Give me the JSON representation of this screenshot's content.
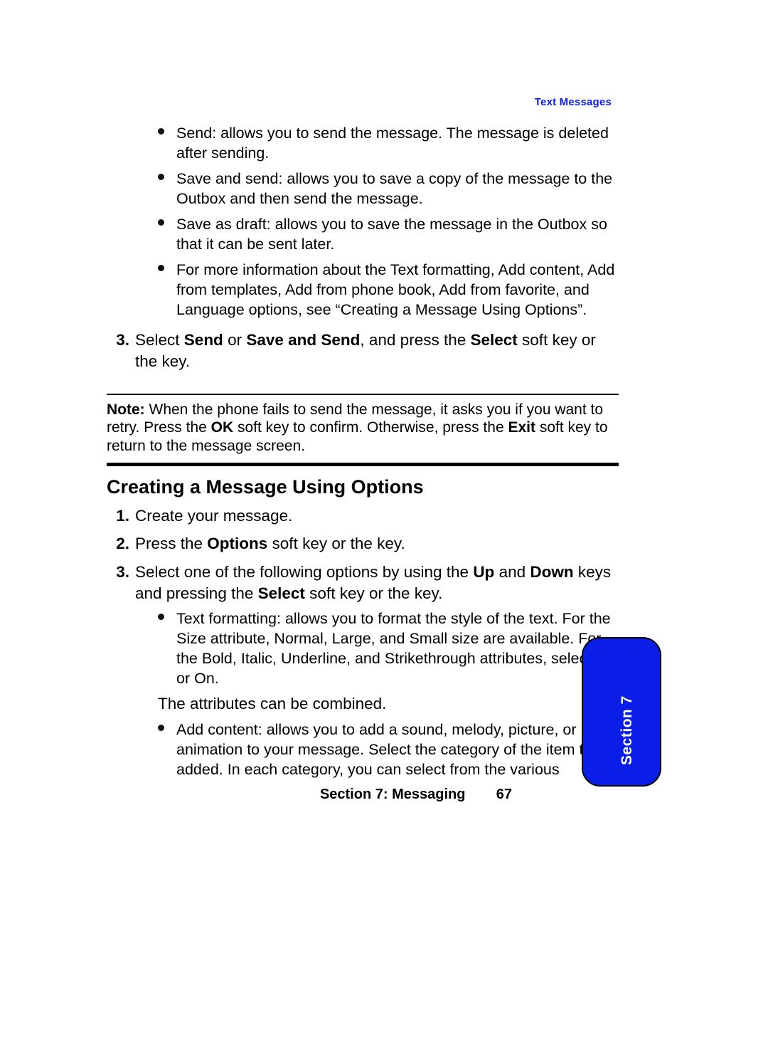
{
  "header": {
    "section_label": "Text Messages"
  },
  "continuing_bullets": [
    "Send: allows you to send the message. The message is deleted after sending.",
    "Save and send: allows you to save a copy of the message to the Outbox and then send the message.",
    "Save as draft: allows you to save the message in the Outbox so that it can be sent later.",
    "For more information about the Text formatting, Add content, Add from  templates, Add from phone book, Add from favorite, and Language options, see “Creating a Message Using Options”."
  ],
  "step3": {
    "number": "3.",
    "prefix": "Select ",
    "bold1": "Send",
    "mid1": " or ",
    "bold2": "Save and Send",
    "mid2": ", and press the ",
    "bold3": "Select",
    "suffix": " soft key or the      key."
  },
  "note": {
    "label": "Note:",
    "text_before_ok": " When the phone fails to send the message, it asks you if you want to retry. Press the ",
    "ok": "OK",
    "text_mid": " soft key to confirm. Otherwise, press the ",
    "exit": "Exit",
    "text_after": " soft key to return to the message screen."
  },
  "heading": "Creating a Message Using Options",
  "steps2": {
    "s1": {
      "num": "1.",
      "text": "Create your message."
    },
    "s2": {
      "num": "2.",
      "pre": "Press the ",
      "bold": "Options",
      "post": " soft key or the       key."
    },
    "s3": {
      "num": "3.",
      "pre": "Select one of the following options by using the ",
      "up": "Up",
      "mid1": " and ",
      "down": "Down",
      "mid2": " keys and pressing the ",
      "select": "Select",
      "post": " soft key or the key."
    }
  },
  "sub2": [
    "Text formatting: allows you to format the style of the text. For the Size attribute, Normal, Large, and Small size are available. For the Bold, Italic, Underline, and Strikethrough attributes, select Off or On."
  ],
  "combine_note": "The attributes can be combined.",
  "sub3": [
    "Add content: allows you to add a sound, melody, picture, or animation to your message. Select the category of the item to be added. In each category, you can select from the various"
  ],
  "footer": {
    "label": "Section 7: Messaging",
    "page": "67"
  },
  "tab": {
    "label": "Section 7"
  }
}
